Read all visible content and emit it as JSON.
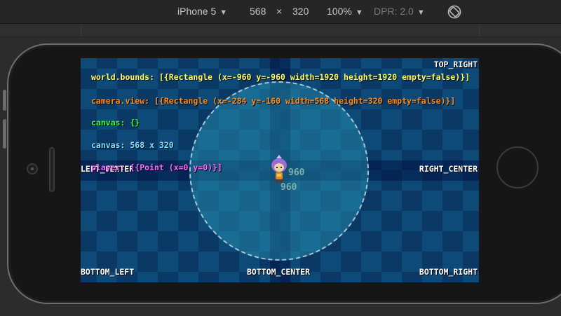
{
  "toolbar": {
    "device": "iPhone 5",
    "width": "568",
    "times": "×",
    "height": "320",
    "zoom": "100%",
    "dpr": "DPR: 2.0"
  },
  "game": {
    "labels": {
      "top_right": "TOP_RIGHT",
      "left_center": "LEFT_CENTER",
      "right_center": "RIGHT_CENTER",
      "bottom_left": "BOTTOM_LEFT",
      "bottom_center": "BOTTOM_CENTER",
      "bottom_right": "BOTTOM_RIGHT"
    },
    "debug": {
      "world_bounds": "world.bounds: [{Rectangle (x=-960 y=-960 width=1920 height=1920 empty=false)}]",
      "camera_view": "camera.view: [{Rectangle (x=-284 y=-160 width=568 height=320 empty=false)}]",
      "canvas_obj": "canvas: {}",
      "canvas_size": "canvas: 568 x 320",
      "player": "player: [{Point (x=0 y=0)}]"
    },
    "numbers": {
      "top": "960",
      "bottom": "960"
    },
    "colors": {
      "world_bounds": "#ffff66",
      "camera_view": "#ff8c1a",
      "canvas_obj": "#33ff33",
      "canvas_size": "#7fe3ff",
      "player": "#ff66ff"
    }
  }
}
